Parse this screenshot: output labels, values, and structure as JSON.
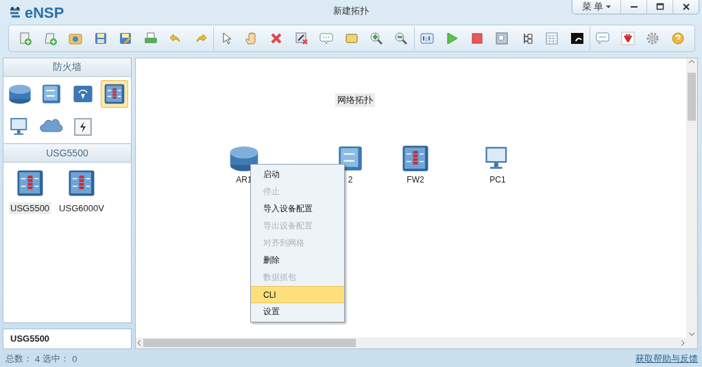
{
  "window": {
    "app_name": "eNSP",
    "title": "新建拓扑",
    "menu_button": "菜 单"
  },
  "device_panel": {
    "title": "防火墙",
    "types": [
      {
        "kind": "router",
        "selected": false
      },
      {
        "kind": "switch",
        "selected": false
      },
      {
        "kind": "wireless",
        "selected": false
      },
      {
        "kind": "firewall",
        "selected": true
      },
      {
        "kind": "pc",
        "selected": false
      },
      {
        "kind": "cloud",
        "selected": false
      },
      {
        "kind": "power",
        "selected": false
      }
    ]
  },
  "model_panel": {
    "title": "USG5500",
    "models": [
      {
        "kind": "firewall",
        "label": "USG5500",
        "selected": true
      },
      {
        "kind": "firewall",
        "label": "USG6000V",
        "selected": false
      }
    ]
  },
  "description_panel": {
    "text": "USG5500"
  },
  "canvas": {
    "title": "网络拓扑",
    "nodes": [
      {
        "kind": "router",
        "label": "AR1"
      },
      {
        "kind": "switch",
        "label": "2"
      },
      {
        "kind": "firewall",
        "label": "FW2"
      },
      {
        "kind": "pc",
        "label": "PC1"
      }
    ]
  },
  "context_menu": {
    "items": [
      {
        "label": "启动",
        "disabled": false,
        "selected": false
      },
      {
        "label": "停止",
        "disabled": true,
        "selected": false
      },
      {
        "label": "导入设备配置",
        "disabled": false,
        "selected": false
      },
      {
        "label": "导出设备配置",
        "disabled": true,
        "selected": false
      },
      {
        "label": "对齐到网格",
        "disabled": true,
        "selected": false
      },
      {
        "label": "删除",
        "disabled": false,
        "selected": false
      },
      {
        "label": "数据抓包",
        "disabled": true,
        "selected": false
      },
      {
        "label": "CLI",
        "disabled": false,
        "selected": true
      },
      {
        "label": "设置",
        "disabled": false,
        "selected": false
      }
    ]
  },
  "status_bar": {
    "total_label": "总数：",
    "total": "4",
    "selected_label": "选中：",
    "selected": "0",
    "help_link": "获取帮助与反馈"
  }
}
